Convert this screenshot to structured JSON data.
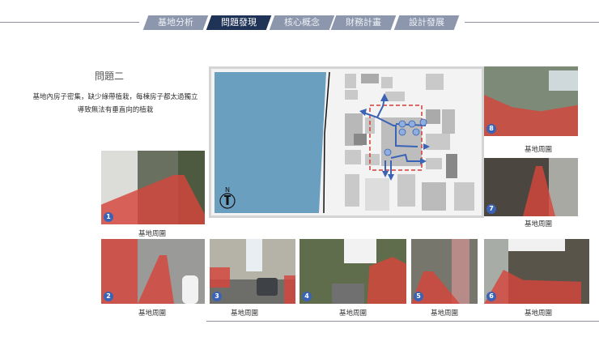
{
  "nav": {
    "tabs": [
      {
        "label": "基地分析"
      },
      {
        "label": "問題發現",
        "active": true
      },
      {
        "label": "核心概念"
      },
      {
        "label": "財務計畫"
      },
      {
        "label": "設計發展"
      }
    ]
  },
  "section": {
    "title": "問題二",
    "description": [
      "基地內房子密集，缺少綠帶植栽，每棟房子都太過獨立",
      "導致無法有垂直向的植栽"
    ]
  },
  "map": {
    "north_label": "N",
    "water_color": "#6b9fc0",
    "boundary_color": "#d83a3a",
    "path_color": "#3a63b5"
  },
  "photos": [
    {
      "number": "1",
      "caption": "基地周圍"
    },
    {
      "number": "2",
      "caption": "基地周圍"
    },
    {
      "number": "3",
      "caption": "基地周圍"
    },
    {
      "number": "4",
      "caption": "基地周圍"
    },
    {
      "number": "5",
      "caption": "基地周圍"
    },
    {
      "number": "6",
      "caption": "基地周圍"
    },
    {
      "number": "7",
      "caption": "基地周圍"
    },
    {
      "number": "8",
      "caption": "基地周圍"
    }
  ]
}
